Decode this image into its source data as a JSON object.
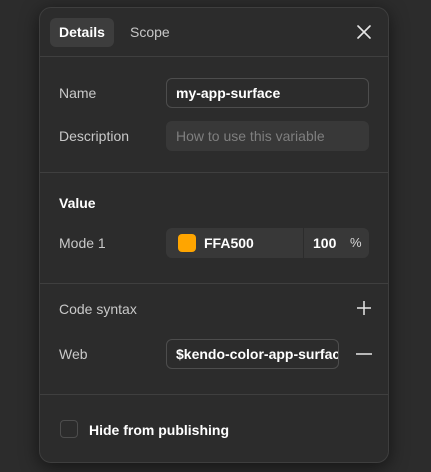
{
  "tabs": [
    {
      "label": "Details",
      "active": true
    },
    {
      "label": "Scope",
      "active": false
    }
  ],
  "close_icon": "close-icon",
  "details": {
    "name_label": "Name",
    "name_value": "my-app-surface",
    "description_label": "Description",
    "description_placeholder": "How to use this variable"
  },
  "value_section": {
    "heading": "Value",
    "mode_label": "Mode 1",
    "color_hex": "FFA500",
    "swatch_color": "#FFA500",
    "opacity": "100",
    "opacity_unit": "%"
  },
  "code_syntax": {
    "heading": "Code syntax",
    "add_icon": "plus-icon",
    "platform_label": "Web",
    "platform_value": "$kendo-color-app-surface",
    "remove_icon": "minus-icon"
  },
  "publishing": {
    "checkbox_label": "Hide from publishing",
    "checked": false
  }
}
